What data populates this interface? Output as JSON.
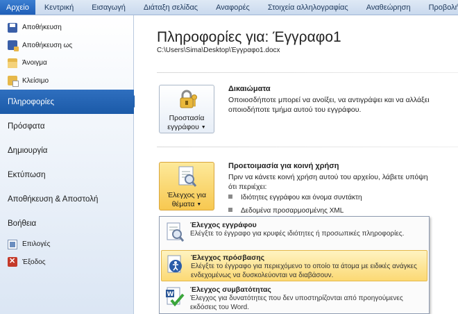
{
  "tabs": [
    "Αρχείο",
    "Κεντρική",
    "Εισαγωγή",
    "Διάταξη σελίδας",
    "Αναφορές",
    "Στοιχεία αλληλογραφίας",
    "Αναθεώρηση",
    "Προβολή"
  ],
  "nav": {
    "save": "Αποθήκευση",
    "save_as": "Αποθήκευση ως",
    "open": "Άνοιγμα",
    "close": "Κλείσιμο",
    "info": "Πληροφορίες",
    "recent": "Πρόσφατα",
    "new": "Δημιουργία",
    "print": "Εκτύπωση",
    "save_send": "Αποθήκευση & Αποστολή",
    "help": "Βοήθεια",
    "options": "Επιλογές",
    "exit": "Έξοδος"
  },
  "main": {
    "title": "Πληροφορίες για: Έγγραφο1",
    "path": "C:\\Users\\Sima\\Desktop\\Έγγραφο1.docx",
    "permissions": {
      "button_line1": "Προστασία",
      "button_line2": "εγγράφου",
      "heading": "Δικαιώματα",
      "text": "Οποιοσδήποτε μπορεί να ανοίξει, να αντιγράψει και να αλλάξει οποιοδήποτε τμήμα αυτού του εγγράφου."
    },
    "sharing": {
      "button_line1": "Έλεγχος για",
      "button_line2": "θέματα",
      "heading": "Προετοιμασία για κοινή χρήση",
      "text": "Πριν να κάνετε κοινή χρήση αυτού του αρχείου, λάβετε υπόψη ότι περιέχει:",
      "bullets": [
        "Ιδιότητες εγγράφου και όνομα συντάκτη",
        "Δεδομένα προσαρμοσμένης XML"
      ]
    }
  },
  "menu": {
    "items": [
      {
        "title": "Έλεγχος εγγράφου",
        "desc": "Ελέγξτε το έγγραφο για κρυφές ιδιότητες ή προσωπικές πληροφορίες."
      },
      {
        "title": "Έλεγχος πρόσβασης",
        "desc": "Ελέγξτε το έγγραφο για περιεχόμενο το οποίο τα άτομα με ειδικές ανάγκες ενδεχομένως να δυσκολεύονται να διαβάσουν."
      },
      {
        "title": "Έλεγχος συμβατότητας",
        "desc": "Έλεγχος για δυνατότητες που δεν υποστηρίζονται από προηγούμενες εκδόσεις του Word."
      }
    ]
  }
}
